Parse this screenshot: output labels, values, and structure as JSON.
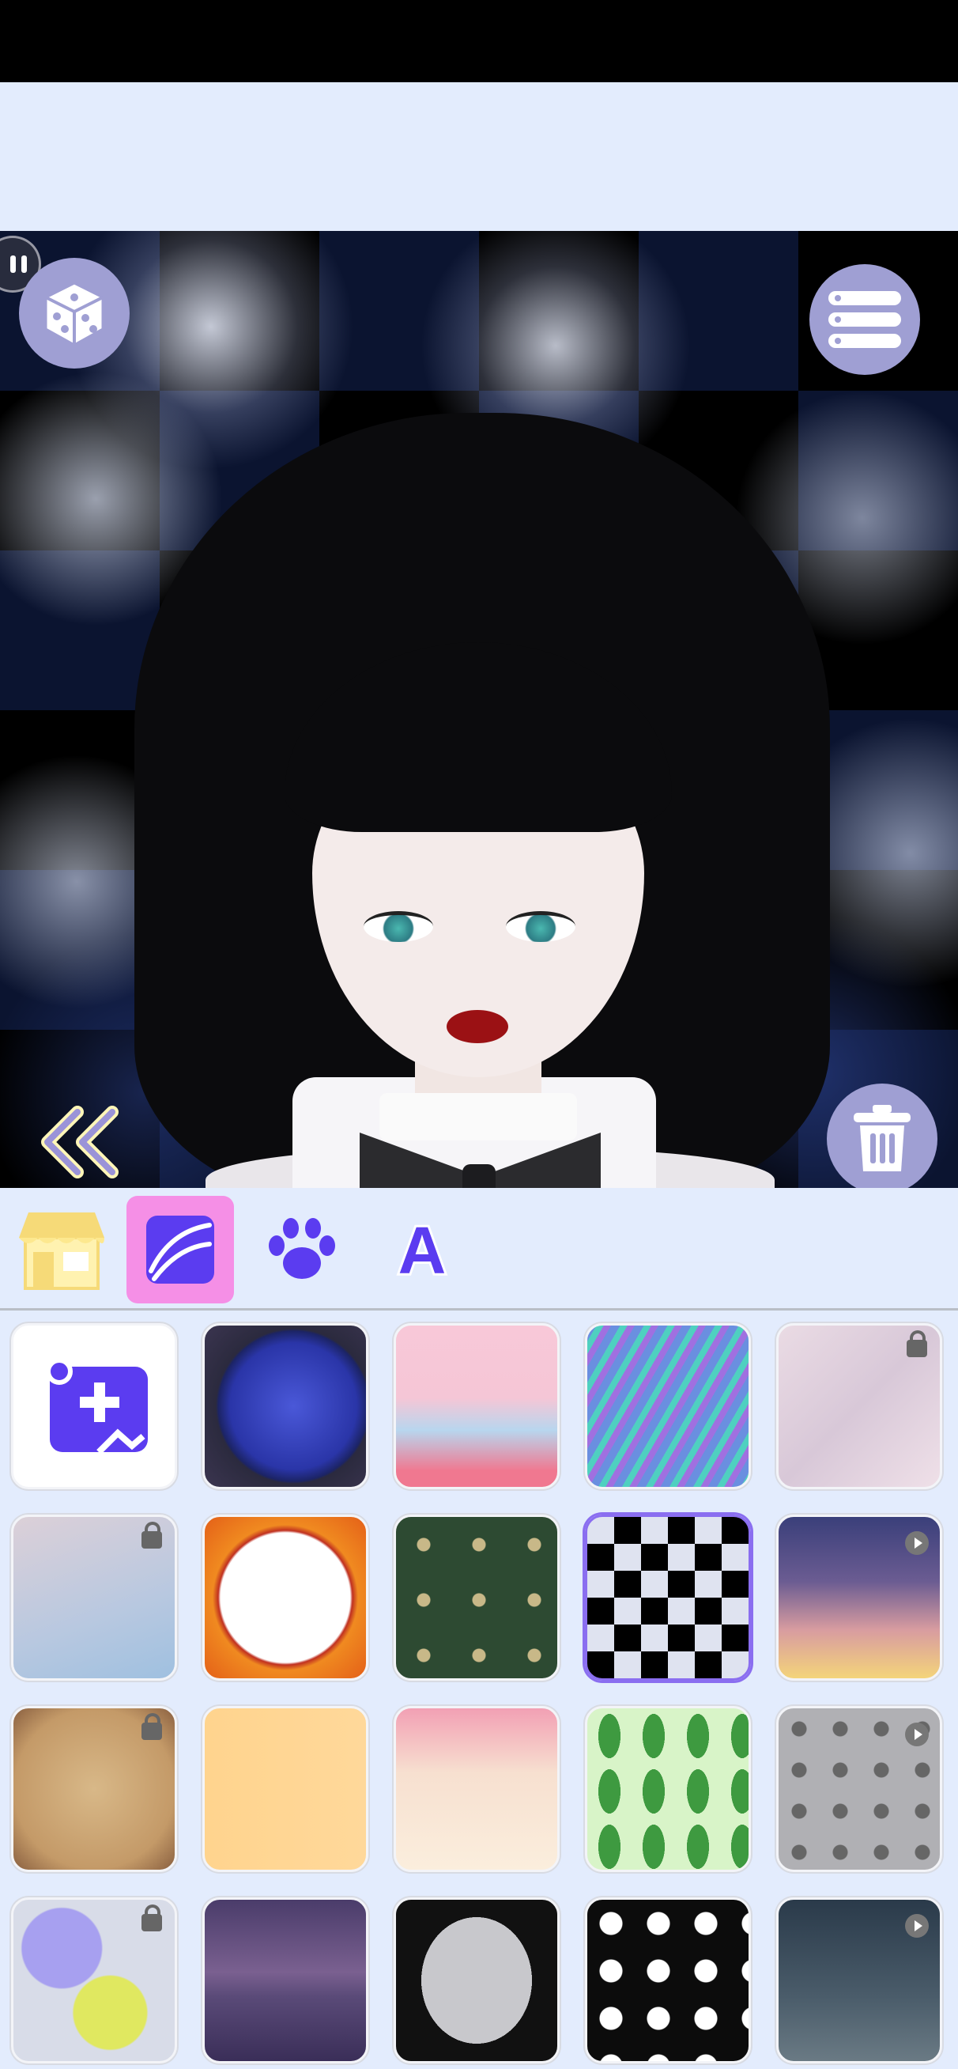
{
  "app": {
    "colors": {
      "background": "#e3ecfd",
      "accent": "#9f9fd3",
      "selected_tab": "#f58fe6",
      "selected_tile_border": "#8a6ef0"
    }
  },
  "canvas": {
    "pause_icon": "pause-icon",
    "dice_icon": "dice-icon",
    "menu_icon": "list-menu-icon",
    "collapse_icon": "double-chevron-left-icon",
    "delete_icon": "trash-icon"
  },
  "toolbar": {
    "tabs": [
      {
        "id": "shop",
        "icon": "shop-icon",
        "selected": false
      },
      {
        "id": "background",
        "icon": "background-image-icon",
        "selected": true
      },
      {
        "id": "pet",
        "icon": "paw-icon",
        "selected": false
      },
      {
        "id": "text",
        "icon": "letter-a-icon",
        "text": "A",
        "selected": false
      }
    ]
  },
  "backgrounds": [
    {
      "name": "add-custom-photo",
      "icon": "add-photo-icon",
      "locked": false,
      "ad": false
    },
    {
      "name": "galaxy-moon",
      "locked": false,
      "ad": false
    },
    {
      "name": "pastel-clouds",
      "locked": false,
      "ad": false
    },
    {
      "name": "blue-swirl",
      "locked": false,
      "ad": false
    },
    {
      "name": "pink-marble",
      "locked": true,
      "ad": false
    },
    {
      "name": "watercolor-wash",
      "locked": true,
      "ad": false
    },
    {
      "name": "orange-frame",
      "locked": false,
      "ad": false
    },
    {
      "name": "green-pattern",
      "locked": false,
      "ad": false
    },
    {
      "name": "checkerboard",
      "locked": false,
      "ad": false,
      "selected": true
    },
    {
      "name": "sunset-sky",
      "locked": false,
      "ad": true
    },
    {
      "name": "old-paper",
      "locked": true,
      "ad": false
    },
    {
      "name": "golden-wings",
      "locked": false,
      "ad": false
    },
    {
      "name": "floral-cream",
      "locked": false,
      "ad": false
    },
    {
      "name": "green-leaves",
      "locked": false,
      "ad": false
    },
    {
      "name": "gray-skulls",
      "locked": false,
      "ad": true
    },
    {
      "name": "paint-splash",
      "locked": true,
      "ad": false
    },
    {
      "name": "purple-lake",
      "locked": false,
      "ad": false
    },
    {
      "name": "halloween-frame",
      "locked": false,
      "ad": false
    },
    {
      "name": "ghosts-boo",
      "locked": false,
      "ad": false
    },
    {
      "name": "night-clouds",
      "locked": false,
      "ad": true
    }
  ]
}
